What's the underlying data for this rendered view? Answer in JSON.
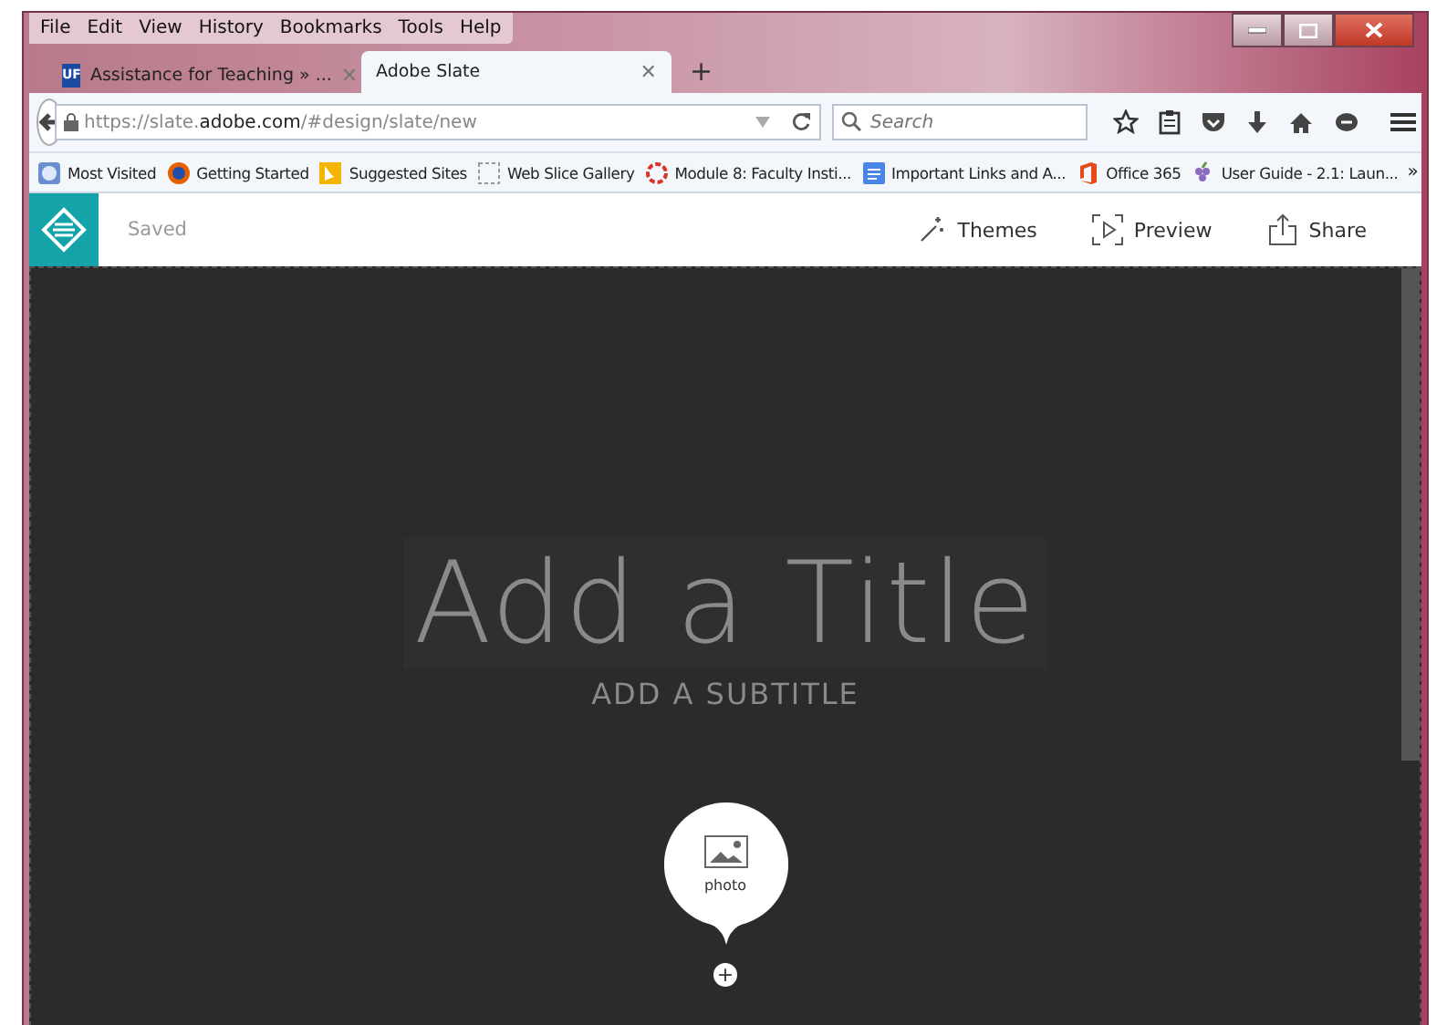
{
  "menu": [
    "File",
    "Edit",
    "View",
    "History",
    "Bookmarks",
    "Tools",
    "Help"
  ],
  "tabs": [
    {
      "label": "Assistance for Teaching » ...",
      "selected": false,
      "kind": "uf",
      "icon_text": "UF",
      "close": "✕"
    },
    {
      "label": "Adobe Slate",
      "selected": true,
      "kind": "plain",
      "close": "✕"
    }
  ],
  "new_tab": "+",
  "address": {
    "prefix": "https://slate.",
    "domain": "adobe.com",
    "path": "/#design/slate/new"
  },
  "search": {
    "placeholder": "Search"
  },
  "bookmarks": [
    {
      "label": "Most Visited",
      "kind": "globe"
    },
    {
      "label": "Getting Started",
      "kind": "firefox"
    },
    {
      "label": "Suggested Sites",
      "kind": "bing"
    },
    {
      "label": "Web Slice Gallery",
      "kind": "slice"
    },
    {
      "label": "Module 8: Faculty Insti...",
      "kind": "ring"
    },
    {
      "label": "Important Links and A...",
      "kind": "doc"
    },
    {
      "label": "Office 365",
      "kind": "office"
    },
    {
      "label": "User Guide - 2.1: Laun...",
      "kind": "grapes"
    }
  ],
  "bookmarks_more": "»",
  "app": {
    "status": "Saved",
    "actions": [
      {
        "label": "Themes",
        "kind": "wand"
      },
      {
        "label": "Preview",
        "kind": "play"
      },
      {
        "label": "Share",
        "kind": "share"
      }
    ]
  },
  "canvas": {
    "title": "Add a Title",
    "subtitle": "ADD A SUBTITLE",
    "photo_label": "photo",
    "add": "+"
  }
}
